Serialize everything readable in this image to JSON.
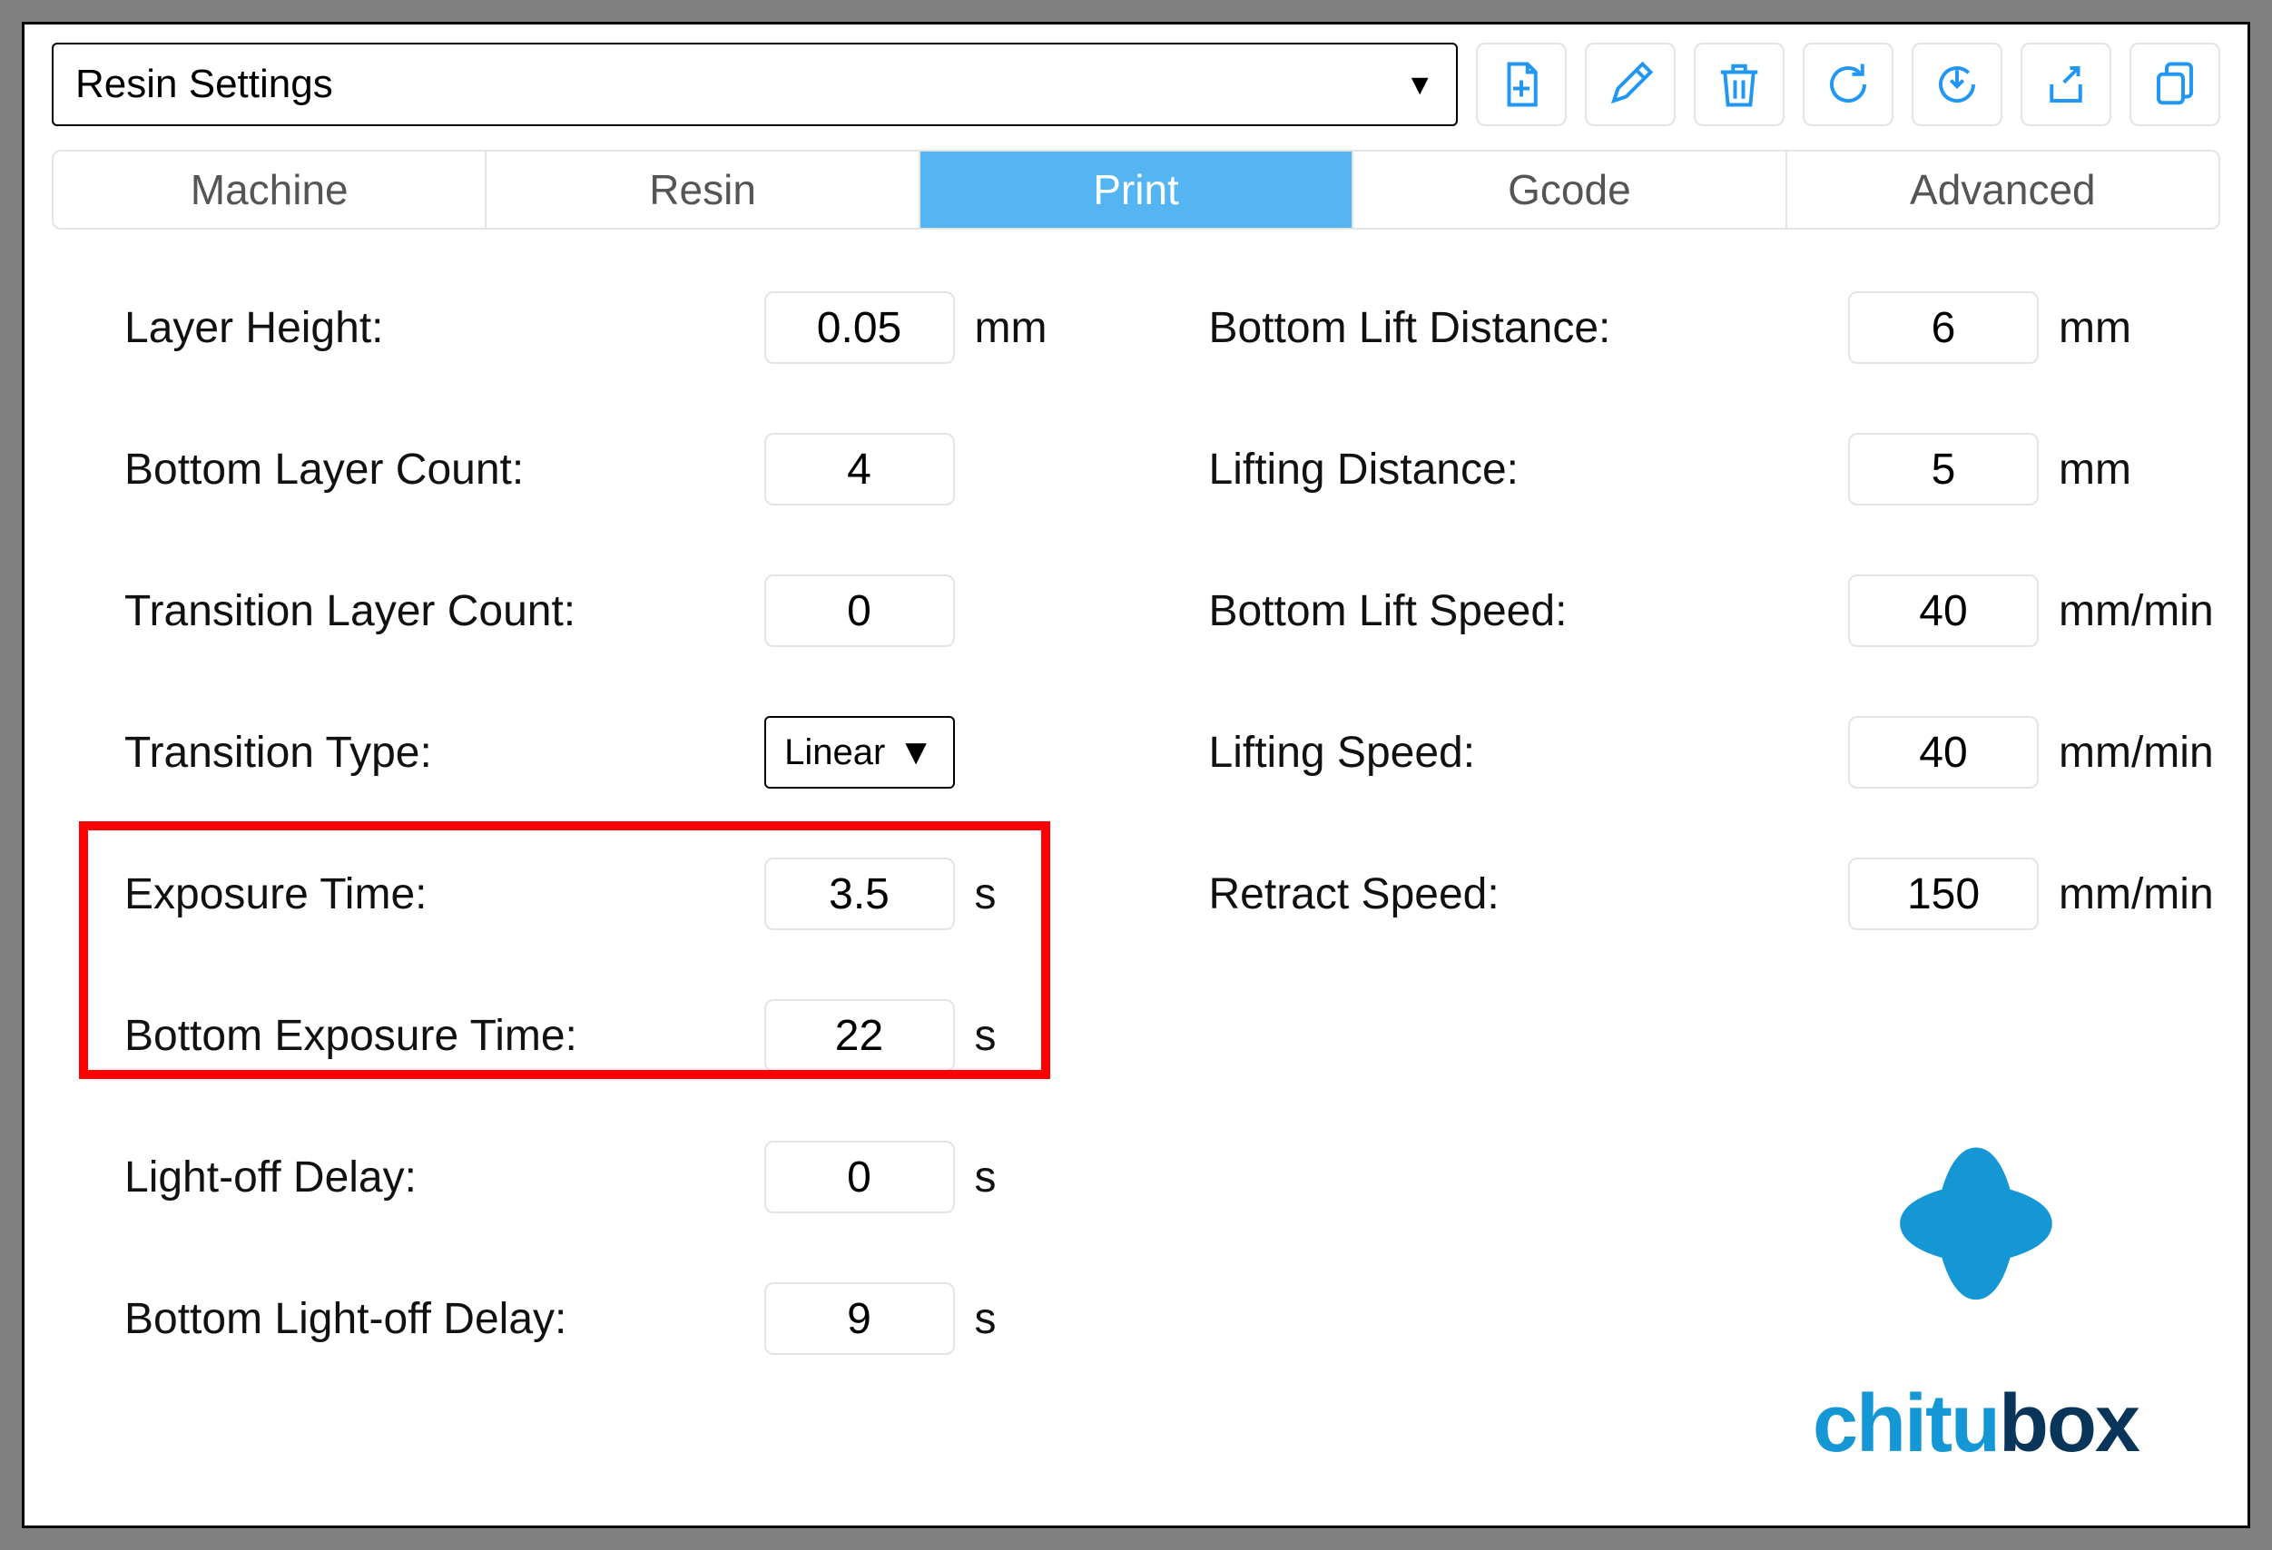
{
  "profile": {
    "name": "Resin Settings"
  },
  "toolbar_icons": [
    "add-file-icon",
    "edit-icon",
    "delete-icon",
    "refresh-icon",
    "import-icon",
    "export-icon",
    "copy-icon"
  ],
  "tabs": [
    "Machine",
    "Resin",
    "Print",
    "Gcode",
    "Advanced"
  ],
  "active_tab": "Print",
  "left": [
    {
      "label": "Layer Height:",
      "value": "0.05",
      "unit": "mm",
      "type": "input"
    },
    {
      "label": "Bottom Layer Count:",
      "value": "4",
      "unit": "",
      "type": "input"
    },
    {
      "label": "Transition Layer Count:",
      "value": "0",
      "unit": "",
      "type": "input"
    },
    {
      "label": "Transition Type:",
      "value": "Linear",
      "unit": "",
      "type": "select"
    },
    {
      "label": "Exposure Time:",
      "value": "3.5",
      "unit": "s",
      "type": "input"
    },
    {
      "label": "Bottom Exposure Time:",
      "value": "22",
      "unit": "s",
      "type": "input"
    },
    {
      "label": "Light-off Delay:",
      "value": "0",
      "unit": "s",
      "type": "input"
    },
    {
      "label": "Bottom Light-off Delay:",
      "value": "9",
      "unit": "s",
      "type": "input"
    }
  ],
  "right": [
    {
      "label": "Bottom Lift Distance:",
      "value": "6",
      "unit": "mm"
    },
    {
      "label": "Lifting Distance:",
      "value": "5",
      "unit": "mm"
    },
    {
      "label": "Bottom Lift Speed:",
      "value": "40",
      "unit": "mm/min"
    },
    {
      "label": "Lifting Speed:",
      "value": "40",
      "unit": "mm/min"
    },
    {
      "label": "Retract Speed:",
      "value": "150",
      "unit": "mm/min"
    }
  ],
  "logo": {
    "part1": "chitu",
    "part2": "box"
  }
}
